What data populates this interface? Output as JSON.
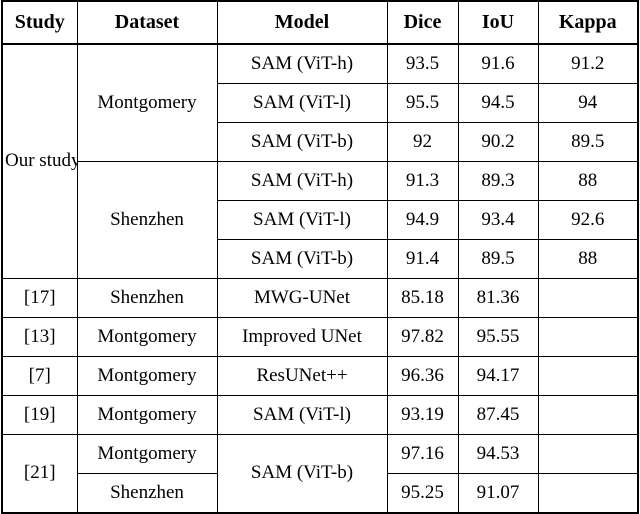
{
  "table": {
    "caption": "",
    "columns": [
      {
        "key": "study",
        "label": "Study"
      },
      {
        "key": "dataset",
        "label": "Dataset"
      },
      {
        "key": "model",
        "label": "Model"
      },
      {
        "key": "dice",
        "label": "Dice"
      },
      {
        "key": "iou",
        "label": "IoU"
      },
      {
        "key": "kappa",
        "label": "Kappa"
      }
    ],
    "groups": {
      "our_study": {
        "study_label": "Our study",
        "datasets": [
          {
            "name": "Montgomery",
            "rows": [
              {
                "model": "SAM (ViT-h)",
                "dice": "93.5",
                "iou": "91.6",
                "kappa": "91.2",
                "bold": false
              },
              {
                "model": "SAM (ViT-l)",
                "dice": "95.5",
                "iou": "94.5",
                "kappa": "94",
                "bold": true
              },
              {
                "model": "SAM (ViT-b)",
                "dice": "92",
                "iou": "90.2",
                "kappa": "89.5",
                "bold": false
              }
            ]
          },
          {
            "name": "Shenzhen",
            "rows": [
              {
                "model": "SAM (ViT-h)",
                "dice": "91.3",
                "iou": "89.3",
                "kappa": "88",
                "bold": false
              },
              {
                "model": "SAM (ViT-l)",
                "dice": "94.9",
                "iou": "93.4",
                "kappa": "92.6",
                "bold": true
              },
              {
                "model": "SAM (ViT-b)",
                "dice": "91.4",
                "iou": "89.5",
                "kappa": "88",
                "bold": false
              }
            ]
          }
        ]
      }
    },
    "reference_rows": [
      {
        "study": "[17]",
        "dataset": "Shenzhen",
        "model": "MWG-UNet",
        "dice": "85.18",
        "iou": "81.36",
        "kappa": ""
      },
      {
        "study": "[13]",
        "dataset": "Montgomery",
        "model": "Improved UNet",
        "dice": "97.82",
        "iou": "95.55",
        "kappa": ""
      },
      {
        "study": "[7]",
        "dataset": "Montgomery",
        "model": "ResUNet++",
        "dice": "96.36",
        "iou": "94.17",
        "kappa": ""
      },
      {
        "study": "[19]",
        "dataset": "Montgomery",
        "model": "SAM (ViT-l)",
        "dice": "93.19",
        "iou": "87.45",
        "kappa": ""
      }
    ],
    "last_group": {
      "study": "[21]",
      "model": "SAM (ViT-b)",
      "rows": [
        {
          "dataset": "Montgomery",
          "dice": "97.16",
          "iou": "94.53",
          "kappa": ""
        },
        {
          "dataset": "Shenzhen",
          "dice": "95.25",
          "iou": "91.07",
          "kappa": ""
        }
      ]
    }
  }
}
